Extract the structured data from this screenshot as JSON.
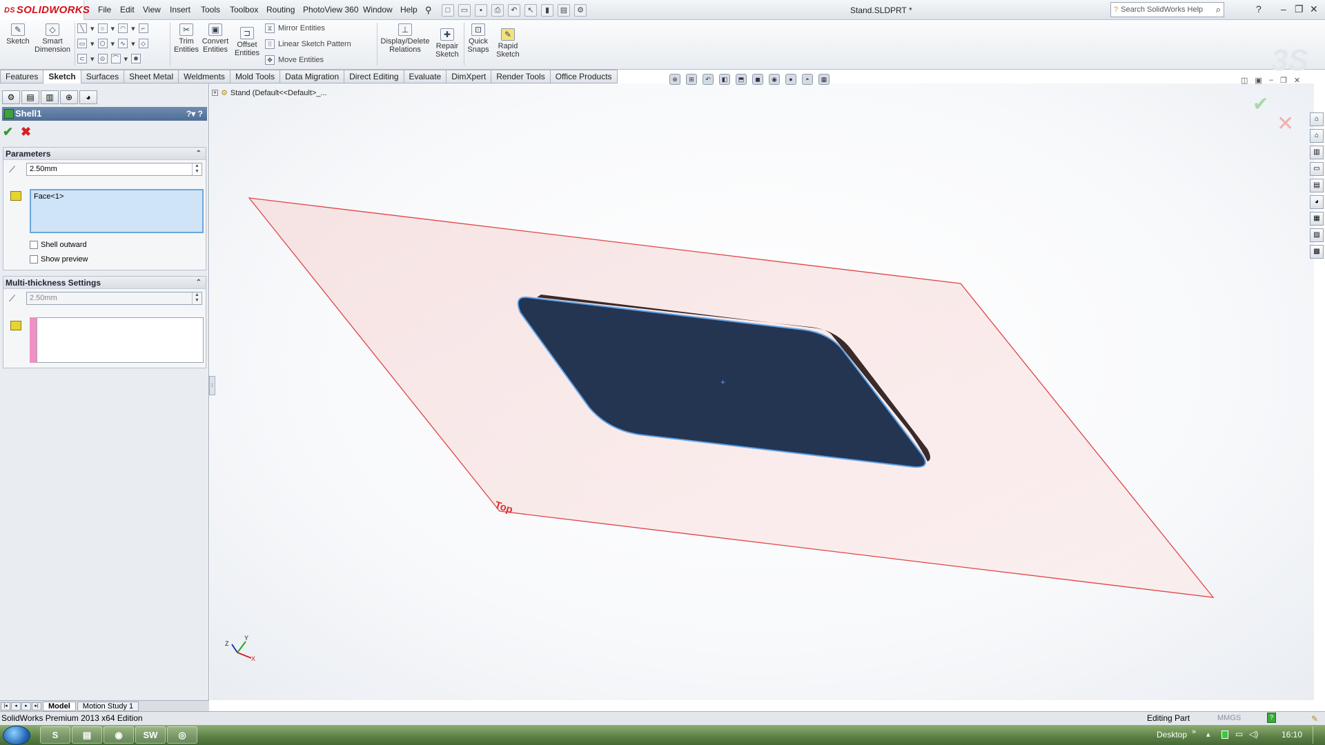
{
  "app": {
    "logo_text": "SOLIDWORKS",
    "title": "Stand.SLDPRT *"
  },
  "menu": [
    "File",
    "Edit",
    "View",
    "Insert",
    "Tools",
    "Toolbox",
    "Routing",
    "PhotoView 360",
    "Window",
    "Help"
  ],
  "search": {
    "placeholder": "Search SolidWorks Help"
  },
  "command_manager": {
    "sketch": "Sketch",
    "smart_dimension": [
      "Smart",
      "Dimension"
    ],
    "trim_entities": [
      "Trim",
      "Entities"
    ],
    "convert_entities": [
      "Convert",
      "Entities"
    ],
    "offset_entities": [
      "Offset",
      "Entities"
    ],
    "mirror_entities": "Mirror Entities",
    "linear_sketch_pattern": "Linear Sketch Pattern",
    "move_entities": "Move Entities",
    "display_delete_relations": [
      "Display/Delete",
      "Relations"
    ],
    "repair_sketch": [
      "Repair",
      "Sketch"
    ],
    "quick_snaps": [
      "Quick",
      "Snaps"
    ],
    "rapid_sketch": [
      "Rapid",
      "Sketch"
    ]
  },
  "tabs": [
    "Features",
    "Sketch",
    "Surfaces",
    "Sheet Metal",
    "Weldments",
    "Mold Tools",
    "Data Migration",
    "Direct Editing",
    "Evaluate",
    "DimXpert",
    "Render Tools",
    "Office Products"
  ],
  "active_tab": "Sketch",
  "tree_flyout": "Stand  (Default<<Default>_...",
  "property_manager": {
    "title": "Shell1",
    "parameters": {
      "heading": "Parameters",
      "thickness": "2.50mm",
      "faces": "Face<1>",
      "shell_outward": "Shell outward",
      "show_preview": "Show preview"
    },
    "multi_thickness": {
      "heading": "Multi-thickness Settings",
      "thickness": "2.50mm"
    }
  },
  "viewport": {
    "plane_label": "Top",
    "triad": {
      "y": "Y",
      "z": "Z",
      "x": "X"
    }
  },
  "bottom_tabs": [
    "Model",
    "Motion Study 1"
  ],
  "status": {
    "edition": "SolidWorks Premium 2013 x64 Edition",
    "mode": "Editing Part",
    "units": "MMGS"
  },
  "taskbar": {
    "desktop": "Desktop",
    "time": "16:10"
  },
  "colors": {
    "part_face": "#243552",
    "plane_edge": "#e04444",
    "accent": "#4f6d96"
  }
}
